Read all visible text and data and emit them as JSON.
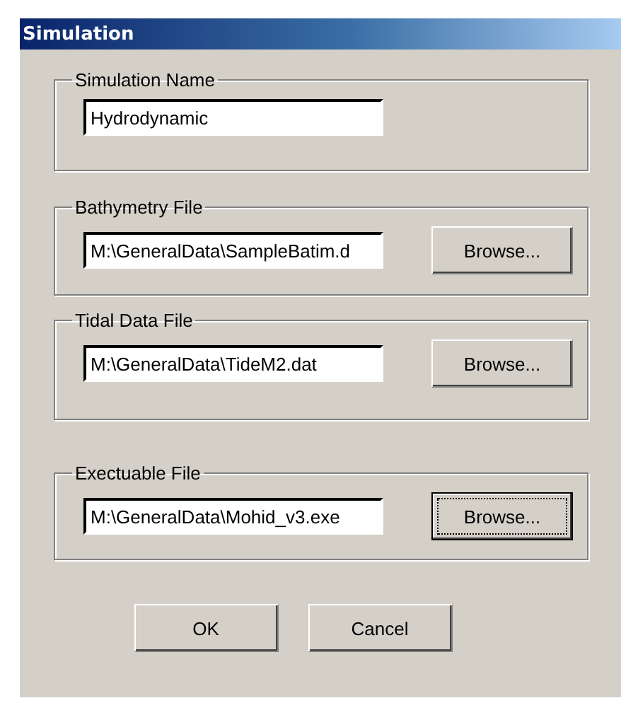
{
  "window": {
    "title": "Simulation"
  },
  "groups": [
    {
      "label": "Simulation Name",
      "value": "Hydrodynamic"
    },
    {
      "label": "Bathymetry File",
      "value": "M:\\GeneralData\\SampleBatim.d",
      "browse": {
        "label": "Browse...",
        "focused": false
      }
    },
    {
      "label": "Tidal Data File",
      "value": "M:\\GeneralData\\TideM2.dat",
      "browse": {
        "label": "Browse...",
        "focused": false
      }
    },
    {
      "label": "Exectuable File",
      "value": "M:\\GeneralData\\Mohid_v3.exe",
      "browse": {
        "label": "Browse...",
        "focused": true
      }
    }
  ],
  "buttons": [
    {
      "label": "OK",
      "focused": false
    },
    {
      "label": "Cancel",
      "focused": false
    }
  ]
}
